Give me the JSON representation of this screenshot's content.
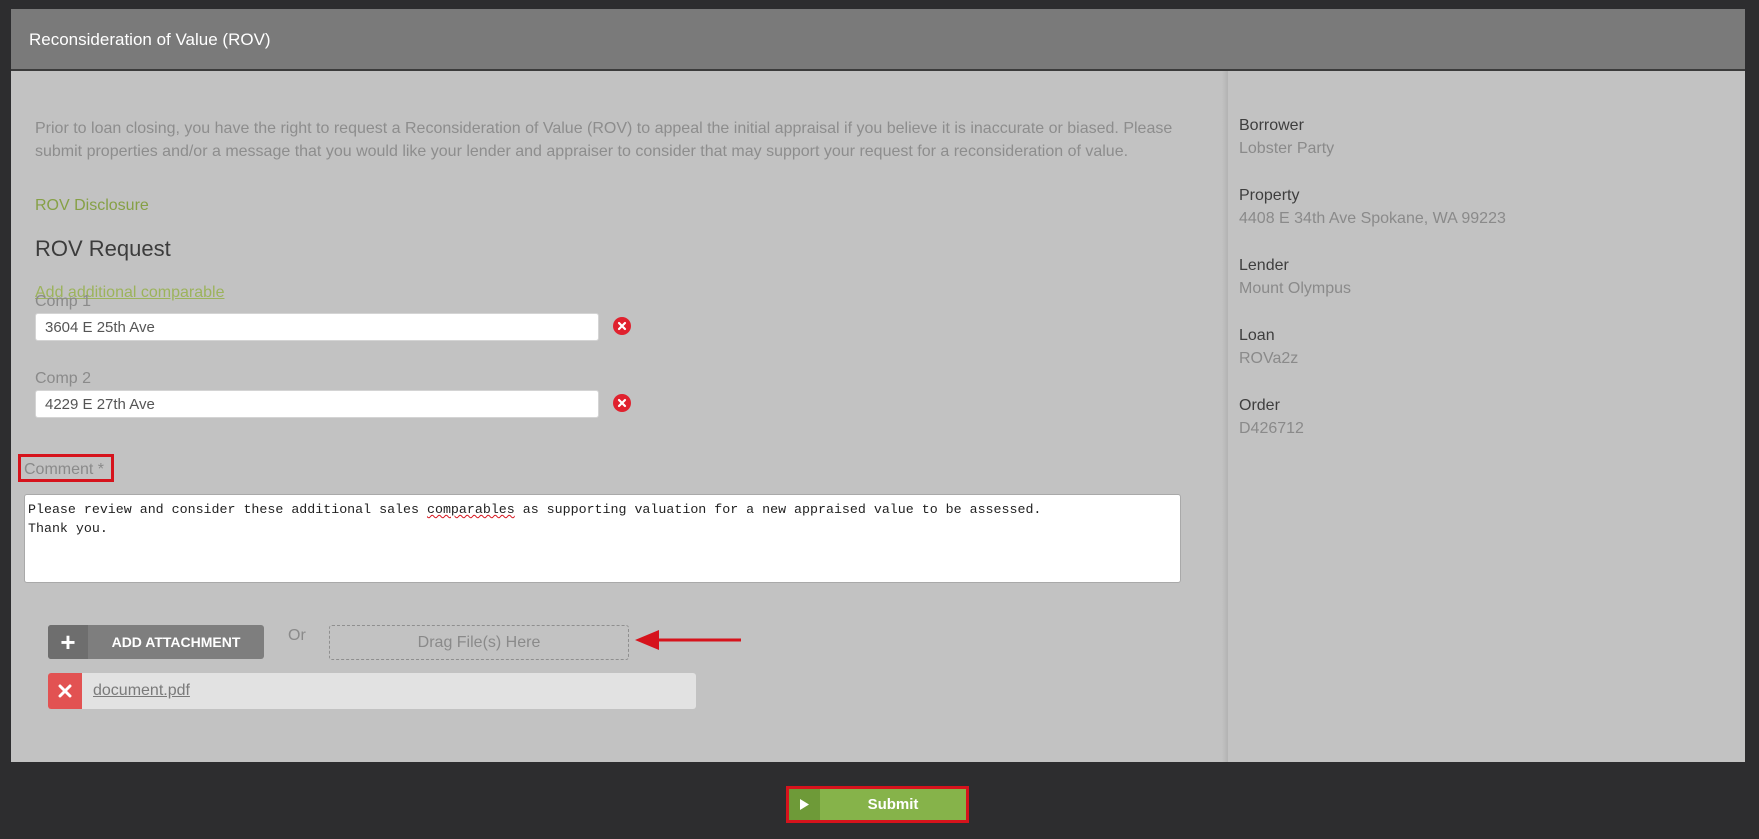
{
  "header": {
    "title": "Reconsideration of Value (ROV)"
  },
  "intro": {
    "text": "Prior to loan closing, you have the right to request a Reconsideration of Value (ROV) to appeal the initial appraisal if you believe it is inaccurate or biased. Please submit properties and/or a message that you would like your lender and appraiser to consider that may support your request for a reconsideration of value.",
    "disclosure_link": "ROV Disclosure"
  },
  "request": {
    "title": "ROV Request",
    "add_comparable": "Add additional comparable",
    "comps": [
      {
        "label": "Comp 1",
        "value": "3604 E 25th Ave"
      },
      {
        "label": "Comp 2",
        "value": "4229 E 27th Ave"
      }
    ],
    "comment": {
      "label": "Comment *",
      "text_before": "Please review and consider these additional sales ",
      "text_misspelled": "comparables",
      "text_after": " as supporting valuation for a new appraised value to be assessed.\nThank you."
    },
    "attachment": {
      "button_label": "ADD ATTACHMENT",
      "or_text": "Or",
      "dropzone_text": "Drag File(s) Here",
      "files": [
        {
          "name": "document.pdf"
        }
      ]
    }
  },
  "sidebar": {
    "items": [
      {
        "label": "Borrower",
        "value": "Lobster Party"
      },
      {
        "label": "Property",
        "value": "4408 E 34th Ave Spokane, WA 99223"
      },
      {
        "label": "Lender",
        "value": "Mount Olympus"
      },
      {
        "label": "Loan",
        "value": "ROVa2z"
      },
      {
        "label": "Order",
        "value": "D426712"
      }
    ]
  },
  "footer": {
    "submit_label": "Submit"
  },
  "colors": {
    "accent_green": "#86b34a",
    "highlight_red": "#d6131c",
    "remove_red": "#e0212e"
  }
}
